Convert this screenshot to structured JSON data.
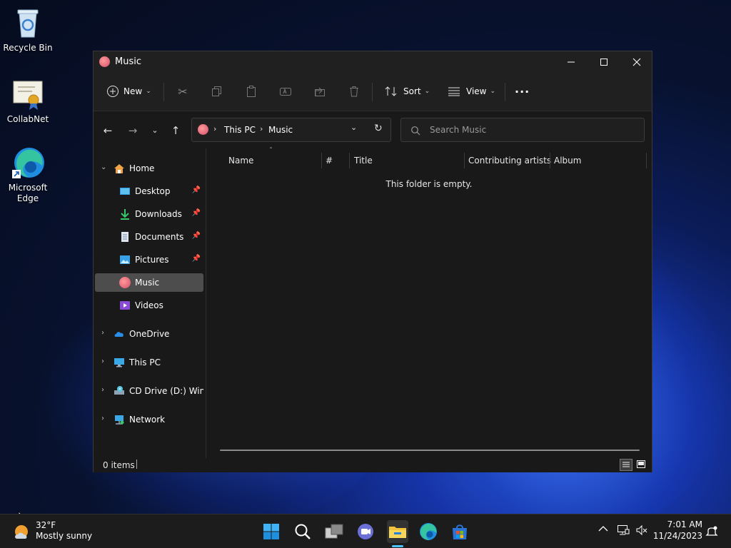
{
  "desktop": {
    "icons": [
      {
        "label": "Recycle Bin"
      },
      {
        "label": "CollabNet"
      },
      {
        "label": "Microsoft Edge"
      }
    ]
  },
  "window": {
    "title": "Music",
    "toolbar": {
      "new_label": "New",
      "sort_label": "Sort",
      "view_label": "View",
      "more_label": "···"
    },
    "address": {
      "crumbs": [
        "This PC",
        "Music"
      ]
    },
    "search": {
      "placeholder": "Search Music"
    },
    "sidebar": {
      "home": "Home",
      "quick": [
        {
          "label": "Desktop",
          "pinned": true
        },
        {
          "label": "Downloads",
          "pinned": true
        },
        {
          "label": "Documents",
          "pinned": true
        },
        {
          "label": "Pictures",
          "pinned": true
        },
        {
          "label": "Music",
          "selected": true
        },
        {
          "label": "Videos"
        }
      ],
      "roots": [
        {
          "label": "OneDrive"
        },
        {
          "label": "This PC"
        },
        {
          "label": "CD Drive (D:) Windo"
        },
        {
          "label": "Network"
        }
      ]
    },
    "columns": [
      "Name",
      "#",
      "Title",
      "Contributing artists",
      "Album"
    ],
    "empty_message": "This folder is empty.",
    "status": {
      "items": "0 items"
    }
  },
  "taskbar": {
    "weather": {
      "temp": "32°F",
      "condition": "Mostly sunny"
    },
    "clock": {
      "time": "7:01 AM",
      "date": "11/24/2023"
    }
  },
  "colors": {
    "accent": "#4cc2ff",
    "selected": "#4d4d4d",
    "window_bg": "#191919",
    "chrome_bg": "#202020"
  }
}
